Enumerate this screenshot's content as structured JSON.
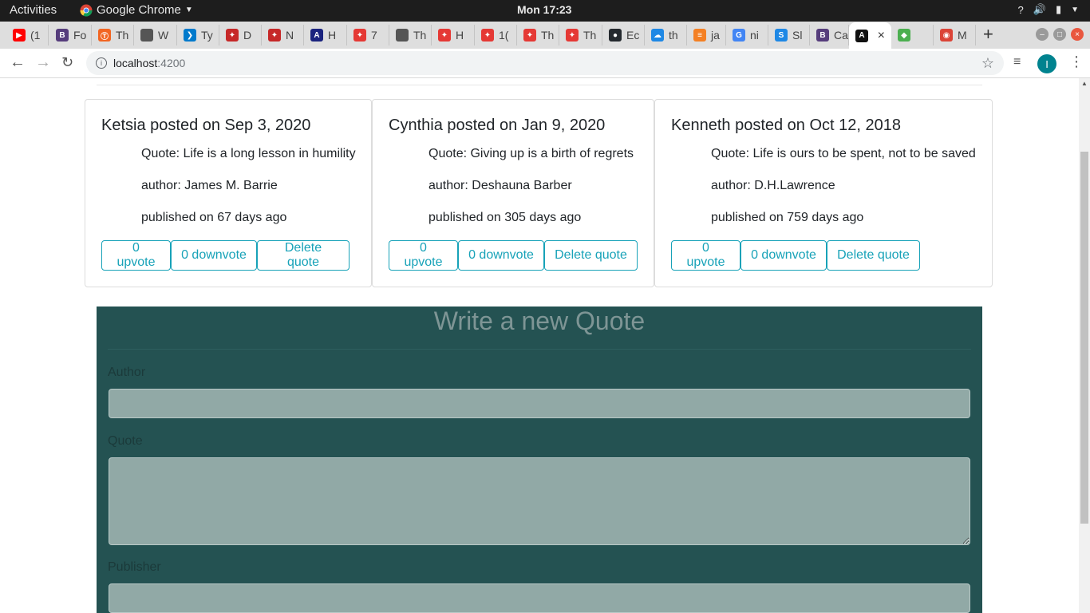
{
  "system_bar": {
    "activities": "Activities",
    "app_name": "Google Chrome",
    "clock": "Mon 17:23"
  },
  "tabs": [
    {
      "label": "(1",
      "icon": "youtube-icon",
      "color": "#ff0000"
    },
    {
      "label": "Fo",
      "icon": "bootstrap-icon",
      "color": "#563d7c"
    },
    {
      "label": "Th",
      "icon": "orange-app-icon",
      "color": "#f26522"
    },
    {
      "label": "W",
      "icon": "blank-favicon",
      "color": "#555555"
    },
    {
      "label": "Ty",
      "icon": "vscode-icon",
      "color": "#007acc"
    },
    {
      "label": "D",
      "icon": "paw-icon",
      "color": "#c62828"
    },
    {
      "label": "N",
      "icon": "paw-icon",
      "color": "#c62828"
    },
    {
      "label": "H",
      "icon": "akc-icon",
      "color": "#1a237e"
    },
    {
      "label": "7",
      "icon": "paw-icon",
      "color": "#e53935"
    },
    {
      "label": "Th",
      "icon": "blank-favicon",
      "color": "#555555"
    },
    {
      "label": "H",
      "icon": "paw-icon",
      "color": "#e53935"
    },
    {
      "label": "1(",
      "icon": "paw-icon",
      "color": "#e53935"
    },
    {
      "label": "Th",
      "icon": "paw-icon",
      "color": "#e53935"
    },
    {
      "label": "Th",
      "icon": "paw-icon",
      "color": "#e53935"
    },
    {
      "label": "Ec",
      "icon": "github-icon",
      "color": "#24292e"
    },
    {
      "label": "th",
      "icon": "cloud-icon",
      "color": "#1e88e5"
    },
    {
      "label": "ja",
      "icon": "stackoverflow-icon",
      "color": "#f48024"
    },
    {
      "label": "ni",
      "icon": "google-icon",
      "color": "#4285f4"
    },
    {
      "label": "Sl",
      "icon": "s-icon",
      "color": "#1e88e5"
    },
    {
      "label": "Ca",
      "icon": "bootstrap-icon",
      "color": "#563d7c"
    },
    {
      "label": "",
      "icon": "angular-icon",
      "color": "#111111",
      "active": true
    },
    {
      "label": "",
      "icon": "multicolor-icon",
      "color": "#4caf50"
    },
    {
      "label": "M",
      "icon": "chrome-icon",
      "color": "#db4437"
    }
  ],
  "address_bar": {
    "host": "localhost",
    "port": ":4200"
  },
  "profile_initial": "I",
  "quotes": [
    {
      "heading": "Ketsia posted on Sep 3, 2020",
      "quote": "Quote: Life is a long lesson in humility",
      "author": "author: James M. Barrie",
      "published": "published on 67 days ago",
      "upvote": "0 upvote",
      "downvote": "0 downvote",
      "delete": "Delete quote"
    },
    {
      "heading": "Cynthia posted on Jan 9, 2020",
      "quote": "Quote: Giving up is a birth of regrets",
      "author": "author: Deshauna Barber",
      "published": "published on 305 days ago",
      "upvote": "0 upvote",
      "downvote": "0 downvote",
      "delete": "Delete quote"
    },
    {
      "heading": "Kenneth posted on Oct 12, 2018",
      "quote": "Quote: Life is ours to be spent, not to be saved",
      "author": "author: D.H.Lawrence",
      "published": "published on 759 days ago",
      "upvote": "0 upvote",
      "downvote": "0 downvote",
      "delete": "Delete quote"
    }
  ],
  "form": {
    "title": "Write a new Quote",
    "author_label": "Author",
    "author_value": "",
    "quote_label": "Quote",
    "quote_value": "",
    "publisher_label": "Publisher",
    "publisher_value": ""
  }
}
